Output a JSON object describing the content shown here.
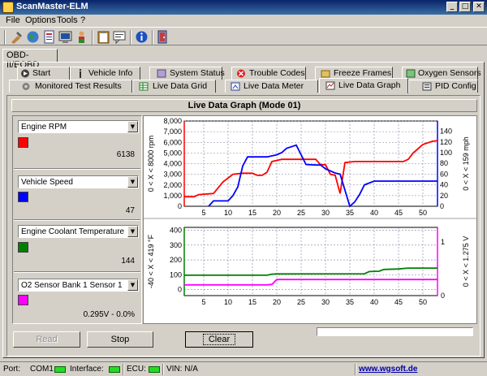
{
  "window": {
    "title": "ScanMaster-ELM"
  },
  "menu": {
    "items": [
      "File",
      "Options",
      "Tools",
      "?"
    ]
  },
  "toolbar": {
    "icons": [
      "connect-icon",
      "globe-icon",
      "report-icon",
      "monitor-icon",
      "person-icon",
      "clipboard-icon",
      "chat-icon",
      "info-icon",
      "exit-icon"
    ]
  },
  "obd_tab": {
    "label": "OBD-II/EOBD"
  },
  "tabs_row1": [
    {
      "label": "Start",
      "icon": "start-icon"
    },
    {
      "label": "Vehicle Info",
      "icon": "info-icon"
    },
    {
      "label": "System Status",
      "icon": "status-icon"
    },
    {
      "label": "Trouble Codes",
      "icon": "error-icon"
    },
    {
      "label": "Freeze Frames",
      "icon": "freeze-icon"
    },
    {
      "label": "Oxygen Sensors",
      "icon": "sensor-icon"
    }
  ],
  "tabs_row2": [
    {
      "label": "Monitored Test Results",
      "icon": "gear-icon"
    },
    {
      "label": "Live Data Grid",
      "icon": "grid-icon"
    },
    {
      "label": "Live Data Meter",
      "icon": "meter-icon"
    },
    {
      "label": "Live Data Graph",
      "icon": "graph-icon"
    },
    {
      "label": "PID Config",
      "icon": "config-icon"
    }
  ],
  "active_tab": "Live Data Graph",
  "graph_title": "Live Data Graph (Mode 01)",
  "pids": [
    {
      "name": "Engine RPM",
      "color": "#ff0000",
      "value": "6138"
    },
    {
      "name": "Vehicle Speed",
      "color": "#0000ff",
      "value": "47"
    },
    {
      "name": "Engine Coolant Temperature",
      "color": "#008000",
      "value": "144"
    },
    {
      "name": "O2 Sensor Bank 1 Sensor 1",
      "color": "#ff00ff",
      "value": "0.295V - 0.0%"
    }
  ],
  "chart_data": [
    {
      "type": "line",
      "left_axis_label": "0 < X < 8000 rpm",
      "right_axis_label": "0 < X < 159 mph",
      "x_ticks": [
        5,
        10,
        15,
        20,
        25,
        30,
        35,
        40,
        45,
        50
      ],
      "xlim": [
        1,
        53
      ],
      "y_left_ticks": [
        "0",
        "1,000",
        "2,000",
        "3,000",
        "4,000",
        "5,000",
        "6,000",
        "7,000",
        "8,000"
      ],
      "y_left_range": [
        0,
        8000
      ],
      "y_right_ticks": [
        "0",
        "20",
        "40",
        "60",
        "80",
        "100",
        "120",
        "140"
      ],
      "y_right_range": [
        0,
        159
      ],
      "series": [
        {
          "name": "Engine RPM",
          "color": "#ff0000",
          "axis": "left",
          "points": [
            [
              1,
              900
            ],
            [
              3,
              900
            ],
            [
              4,
              1100
            ],
            [
              7,
              1200
            ],
            [
              9,
              2300
            ],
            [
              11,
              3000
            ],
            [
              13,
              3100
            ],
            [
              15,
              3100
            ],
            [
              16,
              2900
            ],
            [
              17,
              2900
            ],
            [
              18,
              3200
            ],
            [
              19,
              4200
            ],
            [
              21,
              4400
            ],
            [
              28,
              4400
            ],
            [
              29,
              3900
            ],
            [
              30,
              3900
            ],
            [
              31,
              3000
            ],
            [
              32,
              2900
            ],
            [
              33,
              1200
            ],
            [
              34,
              4100
            ],
            [
              36,
              4200
            ],
            [
              46,
              4200
            ],
            [
              47,
              4400
            ],
            [
              48,
              5000
            ],
            [
              50,
              5800
            ],
            [
              52,
              6100
            ],
            [
              53,
              6150
            ]
          ]
        },
        {
          "name": "Vehicle Speed",
          "color": "#0000ff",
          "axis": "right",
          "points": [
            [
              6,
              0
            ],
            [
              7,
              10
            ],
            [
              9,
              10
            ],
            [
              10,
              10
            ],
            [
              11,
              20
            ],
            [
              12,
              36
            ],
            [
              13,
              75
            ],
            [
              14,
              92
            ],
            [
              16,
              92
            ],
            [
              18,
              92
            ],
            [
              20,
              96
            ],
            [
              21,
              100
            ],
            [
              22,
              108
            ],
            [
              24,
              114
            ],
            [
              25,
              96
            ],
            [
              26,
              78
            ],
            [
              28,
              77
            ],
            [
              29,
              77
            ],
            [
              30,
              70
            ],
            [
              32,
              62
            ],
            [
              33,
              60
            ],
            [
              35,
              0
            ],
            [
              36,
              8
            ],
            [
              37,
              22
            ],
            [
              38,
              40
            ],
            [
              40,
              47
            ],
            [
              53,
              47
            ]
          ]
        }
      ]
    },
    {
      "type": "line",
      "left_axis_label": "-40 < X < 419 °F",
      "right_axis_label": "0 < X < 1.275 V",
      "x_ticks": [
        5,
        10,
        15,
        20,
        25,
        30,
        35,
        40,
        45,
        50
      ],
      "xlim": [
        1,
        53
      ],
      "y_left_ticks": [
        "400",
        "300",
        "200",
        "100",
        "0"
      ],
      "y_left_range": [
        -40,
        419
      ],
      "y_right_ticks": [
        "0",
        "1"
      ],
      "y_right_range": [
        0,
        1.275
      ],
      "series": [
        {
          "name": "Engine Coolant Temperature",
          "color": "#008000",
          "axis": "left",
          "points": [
            [
              1,
              97
            ],
            [
              18,
              97
            ],
            [
              19,
              104
            ],
            [
              20,
              106
            ],
            [
              38,
              107
            ],
            [
              39,
              122
            ],
            [
              41,
              124
            ],
            [
              42,
              136
            ],
            [
              45,
              139
            ],
            [
              47,
              145
            ],
            [
              53,
              145
            ]
          ]
        },
        {
          "name": "O2 Sensor Bank 1 Sensor 1",
          "color": "#ff00ff",
          "axis": "right",
          "points": [
            [
              1,
              0.2
            ],
            [
              18,
              0.2
            ],
            [
              19,
              0.21
            ],
            [
              20,
              0.3
            ],
            [
              53,
              0.3
            ]
          ]
        }
      ]
    }
  ],
  "buttons": {
    "read": "Read",
    "stop": "Stop",
    "clear": "Clear"
  },
  "status": {
    "port_label": "Port:",
    "port_value": "COM1",
    "interface_label": "Interface:",
    "ecu_label": "ECU:",
    "vin_label": "VIN: N/A",
    "website": "www.wgsoft.de"
  },
  "colors": {
    "titlebar": "#0a246a",
    "face": "#d4d0c8",
    "led": "#22dd22"
  }
}
